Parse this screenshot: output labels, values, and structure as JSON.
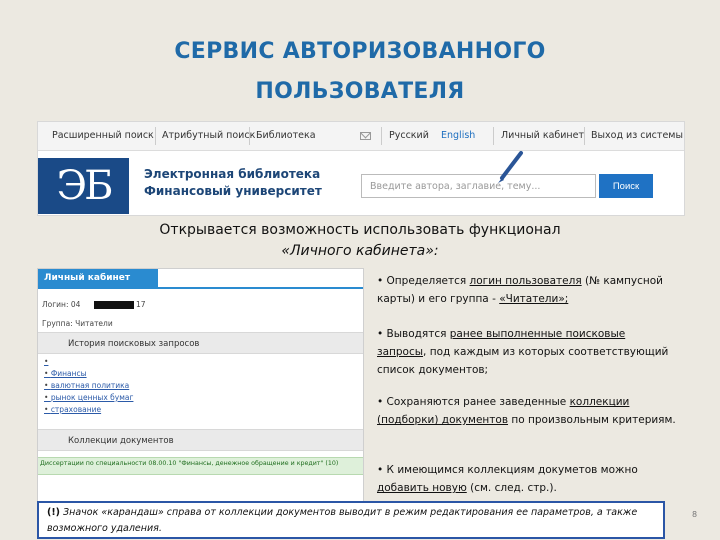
{
  "slide": {
    "title_line1": "СЕРВИС  АВТОРИЗОВАННОГО",
    "title_line2": "ПОЛЬЗОВАТЕЛЯ",
    "page_number": "8"
  },
  "site": {
    "nav": {
      "advanced_search": "Расширенный поиск",
      "attribute_search": "Атрибутный поиск",
      "library": "Библиотека",
      "russian": "Русский",
      "english": "English",
      "personal_cabinet": "Личный кабинет",
      "logout": "Выход из системы"
    },
    "logo_text": "ЭБ",
    "library_name_line1": "Электронная библиотека",
    "library_name_line2": "Финансовый университет",
    "search_placeholder": "Введите автора, заглавие, тему...",
    "search_button": "Поиск"
  },
  "intro": {
    "line1": "Открывается возможность использовать функционал",
    "line2": "«Личного кабинета»:"
  },
  "cabinet": {
    "header": "Личный кабинет",
    "login_label": "Логин: 04",
    "login_suffix": "17",
    "group_label": "Группа: Читатели",
    "history_header": "История поисковых запросов",
    "queries": [
      "",
      "Финансы",
      "валютная политика",
      "рынок ценных бумаг",
      "страхование"
    ],
    "collections_header": "Коллекции документов",
    "collection_item": "Диссертации по специальности 08.00.10 \"Финансы, денежное обращение и кредит\" (10)"
  },
  "bullets": {
    "b1": {
      "pre": "• Определяется ",
      "link1": "логин пользователя",
      "mid": " (№ кампусной карты) и его группа - ",
      "link2": "«Читатели»;"
    },
    "b2": {
      "pre": "• Выводятся ",
      "link": "ранее выполненные поисковые запросы",
      "post": ", под каждым из которых соответствующий список документов;"
    },
    "b3": {
      "pre": "• Сохраняются ранее заведенные ",
      "link": "коллекции (подборки) документов",
      "post": " по произвольным критериям."
    },
    "b4": {
      "pre": "• К имеющимся коллекциям докуметов можно ",
      "link": "добавить новую",
      "post": " (см. след. стр.)."
    }
  },
  "note": {
    "mark": "(!)",
    "text": " Значок «карандаш» справа от коллекции документов выводит в режим редактирования ее параметров, а также возможного удаления."
  }
}
